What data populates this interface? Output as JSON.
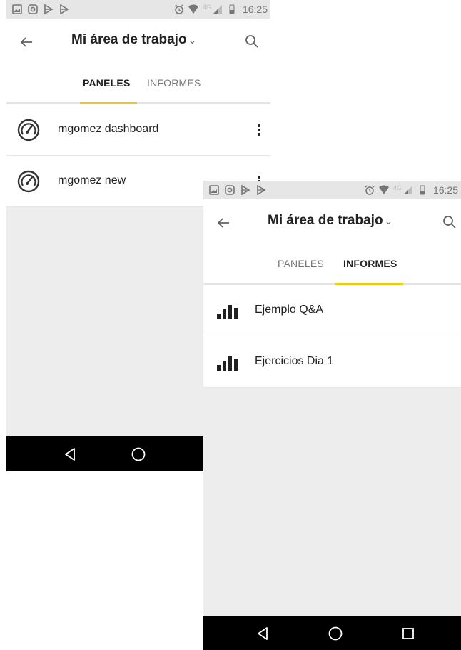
{
  "screens": [
    {
      "status_bar": {
        "network": "4G",
        "time": "16:25"
      },
      "header": {
        "title": "Mi área de trabajo",
        "caret": "⌄"
      },
      "tabs": [
        {
          "label": "PANELES",
          "active": true
        },
        {
          "label": "INFORMES",
          "active": false
        }
      ],
      "items": [
        {
          "label": "mgomez dashboard",
          "icon": "dashboard-gauge-icon"
        },
        {
          "label": "mgomez new",
          "icon": "dashboard-gauge-icon"
        }
      ]
    },
    {
      "status_bar": {
        "network": "4G",
        "time": "16:25"
      },
      "header": {
        "title": "Mi área de trabajo",
        "caret": "⌄"
      },
      "tabs": [
        {
          "label": "PANELES",
          "active": false
        },
        {
          "label": "INFORMES",
          "active": true
        }
      ],
      "items": [
        {
          "label": "Ejemplo Q&A",
          "icon": "report-bar-chart-icon"
        },
        {
          "label": "Ejercicios Dia 1",
          "icon": "report-bar-chart-icon"
        }
      ]
    }
  ],
  "colors": {
    "accent": "#f2c811",
    "surface": "#ffffff",
    "background": "#ededed",
    "navbar": "#000000"
  }
}
